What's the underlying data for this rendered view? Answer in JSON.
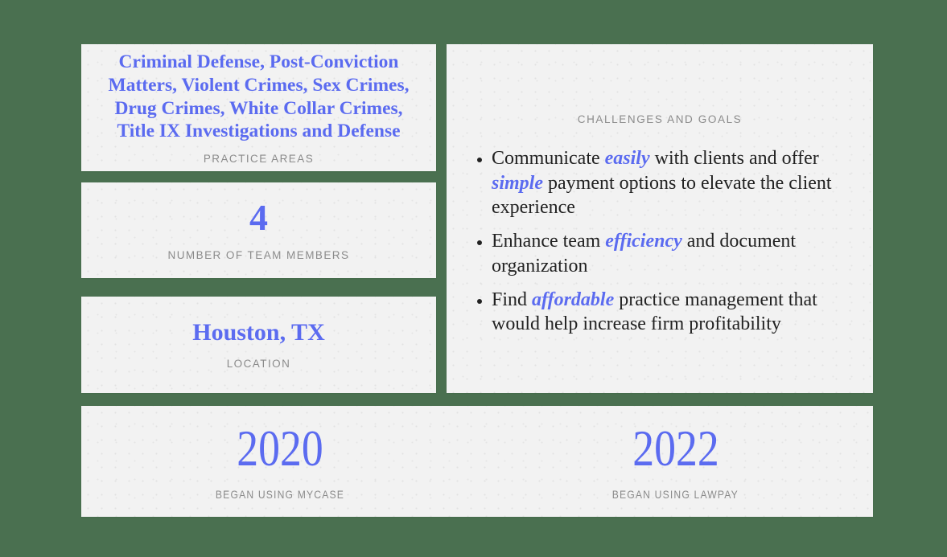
{
  "theme": {
    "background": "#4a7050",
    "card_background": "#f2f2f2",
    "accent": "#5b6bf0",
    "caption_color": "#8b8b8b",
    "body_text_color": "#222222"
  },
  "cards": {
    "practice_areas": {
      "value": "Criminal Defense, Post-Conviction Matters, Violent Crimes, Sex Crimes, Drug Crimes, White Collar Crimes, Title IX Investigations and Defense",
      "caption": "PRACTICE AREAS"
    },
    "team_members": {
      "value": "4",
      "caption": "NUMBER OF TEAM MEMBERS"
    },
    "location": {
      "value": "Houston, TX",
      "caption": "LOCATION"
    },
    "goals": {
      "caption": "CHALLENGES AND GOALS",
      "items": [
        {
          "parts": [
            {
              "text": "Communicate ",
              "emphasis": false
            },
            {
              "text": "easily",
              "emphasis": true
            },
            {
              "text": " with clients and offer ",
              "emphasis": false
            },
            {
              "text": "simple",
              "emphasis": true
            },
            {
              "text": " payment options to elevate the client experience",
              "emphasis": false
            }
          ]
        },
        {
          "parts": [
            {
              "text": "Enhance team ",
              "emphasis": false
            },
            {
              "text": "efficiency",
              "emphasis": true
            },
            {
              "text": " and document organization",
              "emphasis": false
            }
          ]
        },
        {
          "parts": [
            {
              "text": "Find ",
              "emphasis": false
            },
            {
              "text": "affordable",
              "emphasis": true
            },
            {
              "text": " practice management that would help increase firm profitability",
              "emphasis": false
            }
          ]
        }
      ]
    },
    "years": [
      {
        "value": "2020",
        "caption": "BEGAN USING MYCASE"
      },
      {
        "value": "2022",
        "caption": "BEGAN USING LAWPAY"
      }
    ]
  }
}
